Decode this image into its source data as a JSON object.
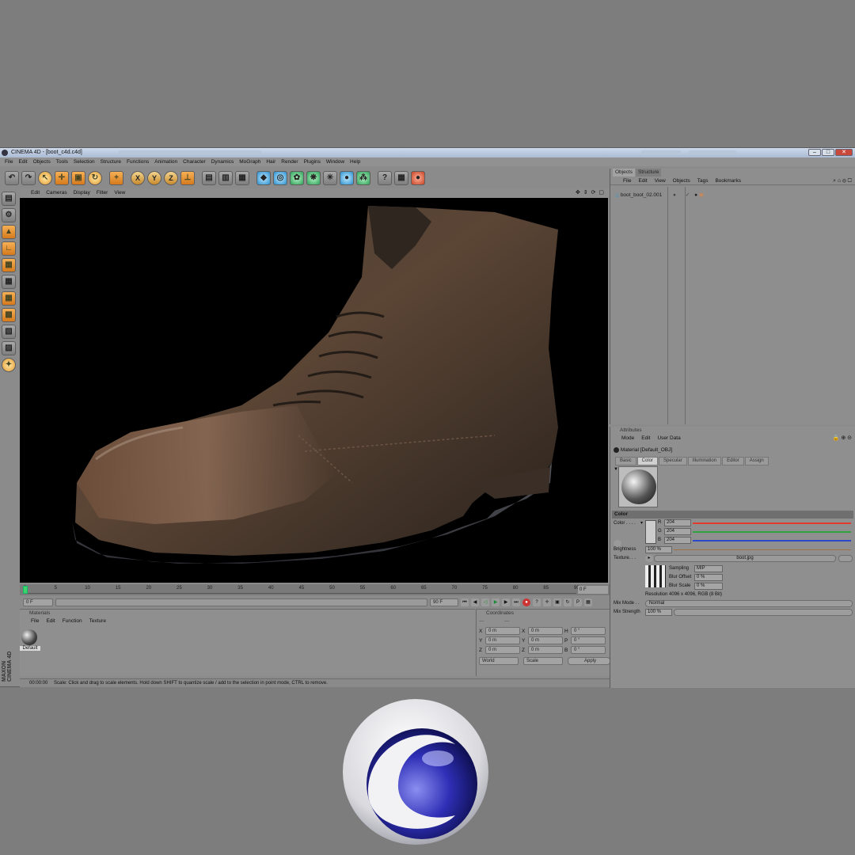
{
  "window": {
    "title": "CINEMA 4D - [boot_c4d.c4d]"
  },
  "menubar": [
    "File",
    "Edit",
    "Objects",
    "Tools",
    "Selection",
    "Structure",
    "Functions",
    "Animation",
    "Character",
    "Dynamics",
    "MoGraph",
    "Hair",
    "Render",
    "Plugins",
    "Window",
    "Help"
  ],
  "toolbar": {
    "row": [
      "undo-icon",
      "redo-icon",
      "live-select-icon",
      "move-icon",
      "scale-icon",
      "rotate-icon",
      "add-icon",
      "x-axis-icon",
      "y-axis-icon",
      "z-axis-icon",
      "coordinate-system-icon",
      "render-view-icon",
      "render-picture-viewer-icon",
      "render-settings-icon",
      "cube-icon",
      "nurbs-icon",
      "array-icon",
      "deformer-icon",
      "scene-icon",
      "light-icon",
      "environment-icon",
      "camera-icon",
      "python-icon",
      "hair-icon"
    ],
    "axis_labels": [
      "X",
      "Y",
      "Z"
    ]
  },
  "leftbar": [
    "model-mode-icon",
    "object-mode-icon",
    "points-mode-icon",
    "edges-mode-icon",
    "polygons-mode-icon",
    "texture-mode-icon",
    "axis-mode-icon",
    "uvw-mode-icon",
    "workplane-icon",
    "snap-icon",
    "sculpt-icon"
  ],
  "brand_vertical": "MAXON CINEMA 4D",
  "viewport": {
    "menu": [
      "Edit",
      "Cameras",
      "Display",
      "Filter",
      "View"
    ]
  },
  "timeline": {
    "ticks": [
      "0",
      "5",
      "10",
      "15",
      "20",
      "25",
      "30",
      "35",
      "40",
      "45",
      "50",
      "55",
      "60",
      "65",
      "70",
      "75",
      "80",
      "85",
      "90"
    ],
    "current_frame": "0 F"
  },
  "transport": {
    "start": "0 F",
    "end": "90 F"
  },
  "materials": {
    "header": "Materials",
    "menu": [
      "File",
      "Edit",
      "Function",
      "Texture"
    ],
    "default_label": "Default"
  },
  "coordinates": {
    "header": "Coordinates",
    "rows": [
      {
        "a": "X",
        "b": "X",
        "c": "H"
      },
      {
        "a": "Y",
        "b": "Y",
        "c": "P"
      },
      {
        "a": "Z",
        "b": "Z",
        "c": "B"
      }
    ],
    "fields": {
      "pos": "0 m",
      "size": "0 m",
      "rot": "0 °"
    },
    "world": "World",
    "scale": "Scale",
    "apply": "Apply"
  },
  "status": {
    "time": "00:00:00",
    "message": "Scale: Click and drag to scale elements. Hold down SHIFT to quantize scale / add to the selection in point mode, CTRL to remove."
  },
  "objects_panel": {
    "tabs": [
      "Objects",
      "Structure"
    ],
    "menu": [
      "File",
      "Edit",
      "View",
      "Objects",
      "Tags",
      "Bookmarks"
    ],
    "object_name": "boot_boot_02.001"
  },
  "attributes": {
    "header": "Attributes",
    "menu": [
      "Mode",
      "Edit",
      "User Data"
    ],
    "material_name": "Material [Default_OBJ]",
    "tabs": [
      "Basic",
      "Color",
      "Specular",
      "Illumination",
      "Editor",
      "Assign"
    ],
    "section": "Color",
    "color_label": "Color . . . .",
    "r_label": "R",
    "g_label": "G",
    "b_label": "B",
    "r": "204",
    "g": "204",
    "b": "204",
    "brightness_label": "Brightness",
    "brightness": "100 %",
    "texture_label": "Texture. . .",
    "texture_file": "boot.jpg",
    "sampling_label": "Sampling",
    "sampling": "MIP",
    "blur_offset_label": "Blur Offset",
    "blur_offset": "0 %",
    "blur_scale_label": "Blur Scale",
    "blur_scale": "0 %",
    "resolution": "Resolution 4096 x 4096, RGB (8 Bit)",
    "mix_mode_label": "Mix Mode . .",
    "mix_mode": "Normal",
    "mix_strength_label": "Mix Strength",
    "mix_strength": "100 %",
    "colors": {
      "r": "#e23b2e",
      "g": "#2fa33f",
      "b": "#2a48c8"
    }
  }
}
